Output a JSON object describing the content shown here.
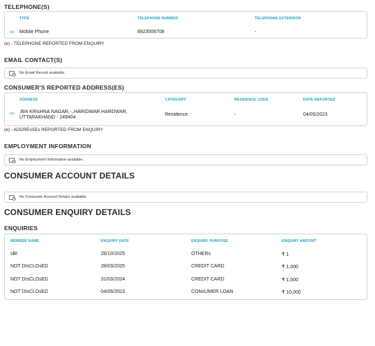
{
  "telephones": {
    "title": "TELEPHONE(S)",
    "headers": [
      "TYPE",
      "TELEPHONE NUMBER",
      "TELEPHONE EXTENSION"
    ],
    "row": {
      "tag": "(e)",
      "type": "Mobile Phone",
      "number": "8923506708",
      "extension": "-"
    },
    "note": "(e) - TELEPHONE REPORTED FROM ENQUIRY"
  },
  "email": {
    "title": "EMAIL CONTACT(S)",
    "empty_text": "No Email Record available."
  },
  "address": {
    "title": "CONSUMER'S REPORTED ADDRESS(ES)",
    "headers": [
      "ADDRESS",
      "CATEGORY",
      "RESIDENCE CODE",
      "DATE REPORTED"
    ],
    "row": {
      "tag": "(e)",
      "address_line1": ",B/4 KRIsHNA NAGAR,-,,HARIDWAR HARDWAR,",
      "address_line2": "UTTARAKHAND - 249404",
      "category": "Residence",
      "residence_code": "-",
      "date_reported": "04/05/2023"
    },
    "note": "(e) - ADDREsSEs REPORTED FROM ENQUIRY"
  },
  "employment": {
    "title": "EMPLOYMENT INFORMATION",
    "empty_text": "No Employment Information available."
  },
  "account": {
    "title": "CONSUMER ACCOUNT DETAILS",
    "empty_text": "No Consumer Account Details available."
  },
  "enquiry_details": {
    "title": "CONSUMER ENQUIRY DETAILS"
  },
  "enquiries": {
    "title": "ENQUIRIES",
    "headers": [
      "MEMBER NAME",
      "ENQUIRY DATE",
      "ENQUIRY PURPOSE",
      "ENQUIRY AMOUNT"
    ],
    "rows": [
      {
        "member": "sBI",
        "date": "28/10/2025",
        "purpose": "OTHERs",
        "amount": "₹ 1"
      },
      {
        "member": "NOT DIsCLOsED",
        "date": "28/03/2025",
        "purpose": "CREDIT CARD",
        "amount": "₹ 1,000"
      },
      {
        "member": "NOT DIsCLOsED",
        "date": "31/03/2024",
        "purpose": "CREDIT CARD",
        "amount": "₹ 1,000"
      },
      {
        "member": "NOT DIsCLOsED",
        "date": "04/05/2023",
        "purpose": "CONsUMER LOAN",
        "amount": "₹ 10,000"
      }
    ]
  },
  "colors": {
    "accent": "#1a9ec4",
    "heading": "#2b2b2b",
    "border": "#d4d4d4"
  },
  "icons": {
    "empty_state": "document-clock-icon"
  }
}
